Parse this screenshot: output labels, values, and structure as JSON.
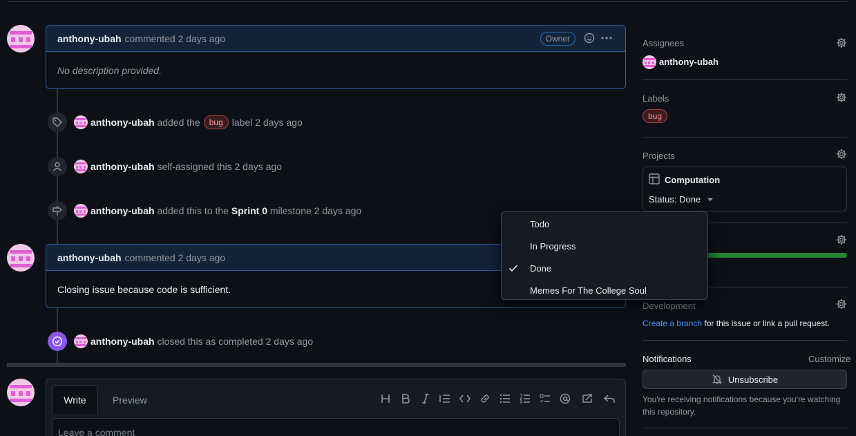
{
  "timeline": {
    "comment1": {
      "author": "anthony-ubah",
      "meta": "commented 2 days ago",
      "role_badge": "Owner",
      "body": "No description provided."
    },
    "event_label": {
      "actor": "anthony-ubah",
      "pre": "added the",
      "label": "bug",
      "post": "label 2 days ago"
    },
    "event_assign": {
      "actor": "anthony-ubah",
      "text": "self-assigned this 2 days ago"
    },
    "event_milestone": {
      "actor": "anthony-ubah",
      "pre": "added this to the",
      "milestone": "Sprint 0",
      "post": "milestone 2 days ago"
    },
    "comment2": {
      "author": "anthony-ubah",
      "meta": "commented 2 days ago",
      "body": "Closing issue because code is sufficient."
    },
    "event_closed": {
      "actor": "anthony-ubah",
      "text": "closed this as completed 2 days ago"
    }
  },
  "editor": {
    "tab_write": "Write",
    "tab_preview": "Preview",
    "placeholder": "Leave a comment"
  },
  "sidebar": {
    "assignees": {
      "heading": "Assignees",
      "user": "anthony-ubah"
    },
    "labels": {
      "heading": "Labels",
      "label": "bug"
    },
    "projects": {
      "heading": "Projects",
      "project_name": "Computation",
      "status": "Status: Done"
    },
    "milestone": {
      "progress": 1.0
    },
    "development": {
      "heading": "Development",
      "link": "Create a branch",
      "rest": "for this issue or link a pull request."
    },
    "notifications": {
      "heading": "Notifications",
      "customize": "Customize",
      "button": "Unsubscribe",
      "note": "You're receiving notifications because you're watching this repository."
    }
  },
  "status_dropdown": {
    "options": [
      "Todo",
      "In Progress",
      "Done",
      "Memes For The College Soul"
    ],
    "selected": "Done"
  },
  "colors": {
    "accent": "#4493f8",
    "success": "#238636",
    "closed_badge": "#8957e5",
    "comment_border": "#2f5f9e"
  }
}
